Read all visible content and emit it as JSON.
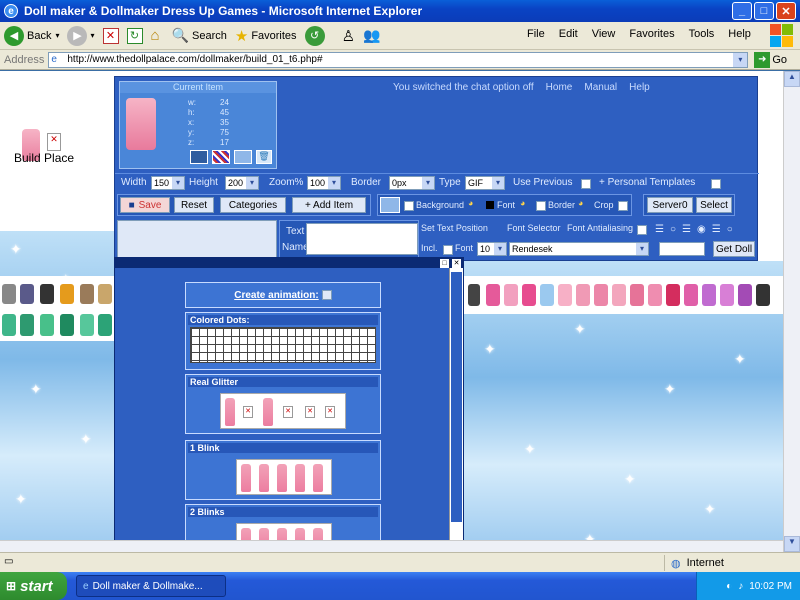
{
  "window": {
    "title": "Doll maker & Dollmaker Dress Up Games - Microsoft Internet Explorer"
  },
  "toolbar": {
    "back": "Back",
    "search": "Search",
    "favorites": "Favorites"
  },
  "menu": [
    "File",
    "Edit",
    "View",
    "Favorites",
    "Tools",
    "Help"
  ],
  "address": {
    "label": "Address",
    "url": "http://www.thedollpalace.com/dollmaker/build_01_t6.php#",
    "go": "Go"
  },
  "page": {
    "build_place": "Build Place",
    "nav": {
      "chat_status": "You switched the chat option off",
      "home": "Home",
      "manual": "Manual",
      "help": "Help"
    },
    "current_item": {
      "title": "Current Item",
      "w_label": "w:",
      "w": "24",
      "h_label": "h:",
      "h": "45",
      "x_label": "x:",
      "x": "35",
      "y_label": "y:",
      "y": "75",
      "z_label": "z:",
      "z": "17"
    },
    "settings": {
      "width_label": "Width",
      "width": "150",
      "height_label": "Height",
      "height": "200",
      "zoom_label": "Zoom%",
      "zoom": "100",
      "border_label": "Border",
      "border": "0px",
      "type_label": "Type",
      "type": "GIF",
      "use_previous": "Use Previous",
      "personal_templates": "+ Personal Templates"
    },
    "buttons": {
      "save": "Save",
      "reset": "Reset",
      "categories": "Categories",
      "add_item": "+ Add Item",
      "select": "Select",
      "get_doll": "Get Doll"
    },
    "color_opts": {
      "background": "Background",
      "font": "Font",
      "border": "Border",
      "crop": "Crop"
    },
    "server": "Server0",
    "text_tools": {
      "text_label": "Text",
      "name_label": "Name",
      "set_text_position": "Set Text Position",
      "font_selector": "Font Selector",
      "font_antialiasing": "Font Antialiasing",
      "incl": "Incl.",
      "font": "Font",
      "font_size": "10",
      "font_name": "Rendesek"
    }
  },
  "popup": {
    "create_animation": "Create animation:",
    "colored_dots": "Colored Dots:",
    "real_glitter": "Real Glitter",
    "one_blink": "1 Blink",
    "two_blinks": "2 Blinks"
  },
  "status": {
    "zone": "Internet"
  },
  "taskbar": {
    "start": "start",
    "task": "Doll maker & Dollmake...",
    "clock": "10:02 PM"
  },
  "colors": {
    "xp_blue": "#0a43c4",
    "panel_blue": "#2e5fc1",
    "start_green": "#2e8b2e"
  }
}
